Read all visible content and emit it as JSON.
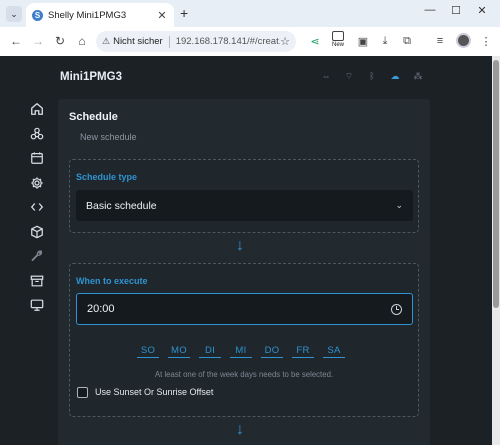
{
  "browser": {
    "tab_title": "Shelly Mini1PMG3",
    "favicon_letter": "S",
    "security_label": "Nicht sicher",
    "url": "192.168.178.141/#/creat...",
    "extension_badge": "New"
  },
  "app": {
    "device_name": "Mini1PMG3",
    "status_icons": [
      "ethernet-icon",
      "wifi-icon",
      "bluetooth-icon",
      "cloud-icon",
      "rss-icon"
    ],
    "accent_color": "#2f93d1",
    "sidebar": [
      "home",
      "components",
      "schedule",
      "settings",
      "code",
      "extensions",
      "tools",
      "archive",
      "device"
    ]
  },
  "schedule": {
    "title": "Schedule",
    "subtitle": "New schedule",
    "type_section": {
      "title": "Schedule type",
      "selected": "Basic schedule"
    },
    "when_section": {
      "title": "When to execute",
      "time": "20:00",
      "days": [
        "SO",
        "MO",
        "DI",
        "MI",
        "DO",
        "FR",
        "SA"
      ],
      "hint": "At least one of the week days needs to be selected.",
      "offset_label": "Use Sunset Or Sunrise Offset",
      "offset_checked": false
    }
  }
}
